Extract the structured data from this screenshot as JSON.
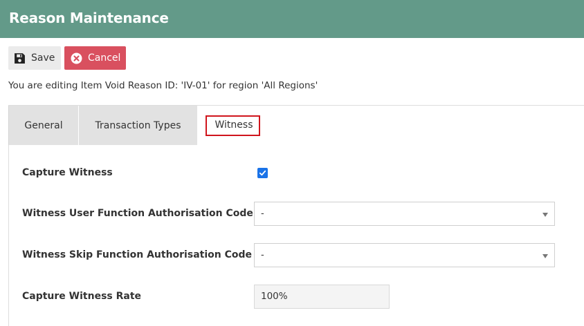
{
  "header": {
    "title": "Reason Maintenance"
  },
  "toolbar": {
    "save_label": "Save",
    "cancel_label": "Cancel"
  },
  "edit_info": "You are editing Item Void Reason ID: 'IV-01' for region 'All Regions'",
  "tabs": [
    {
      "label": "General",
      "active": false
    },
    {
      "label": "Transaction Types",
      "active": false
    },
    {
      "label": "Witness",
      "active": true
    }
  ],
  "witness": {
    "capture_witness": {
      "label": "Capture Witness",
      "checked": true
    },
    "user_function_code": {
      "label": "Witness User Function Authorisation Code",
      "value": "-"
    },
    "skip_function_code": {
      "label": "Witness Skip Function Authorisation Code",
      "value": "-"
    },
    "capture_rate": {
      "label": "Capture Witness Rate",
      "value": "100%"
    }
  },
  "colors": {
    "header": "#639a89",
    "cancel": "#d9505f",
    "checkbox": "#1a73e8",
    "tab_highlight": "#d0141c"
  },
  "icons": {
    "save": "floppy-disk-icon",
    "cancel": "circle-x-icon",
    "checkbox": "checkmark-icon",
    "select": "caret-down-icon"
  }
}
